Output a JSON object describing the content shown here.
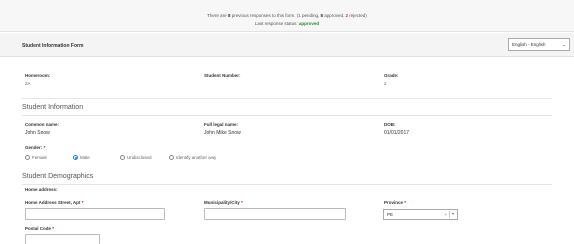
{
  "notice": {
    "prefix": "There are ",
    "count": "8",
    "middle": " previous responses to this form. (1 pending, ",
    "approved": "8",
    "approved_suffix": " approved, ",
    "rejected": "2",
    "rejected_suffix": " rejected)",
    "status_label": "Last response status: ",
    "status_value": "approved"
  },
  "form": {
    "title": "Student Information Form",
    "language": "English - English"
  },
  "header_fields": {
    "homeroom_label": "Homeroom:",
    "homeroom_value": "2A",
    "student_number_label": "Student Number:",
    "grade_label": "Grade:",
    "grade_value": "2"
  },
  "student_info": {
    "heading": "Student Information",
    "common_name_label": "Common name:",
    "common_name_value": "John Snow",
    "legal_name_label": "Full legal name:",
    "legal_name_value": "John Mike Snow",
    "dob_label": "DOB:",
    "dob_value": "01/01/2017",
    "gender_label": "Gender:",
    "gender_options": [
      "Female",
      "Male",
      "Undisclosed",
      "Identify another way"
    ],
    "gender_selected": "Male"
  },
  "demographics": {
    "heading": "Student Demographics",
    "home_address_label": "Home address:",
    "street_label": "Home Address Street, Apt",
    "municipality_label": "Municipality/City",
    "province_label": "Province",
    "province_value": "PE",
    "postal_label": "Postal Code"
  },
  "required_mark": "*",
  "colors": {
    "approved": "#2e8b2e",
    "rejected": "#c0392b",
    "required": "#dd0000",
    "radio_selected": "#2a7de1"
  }
}
